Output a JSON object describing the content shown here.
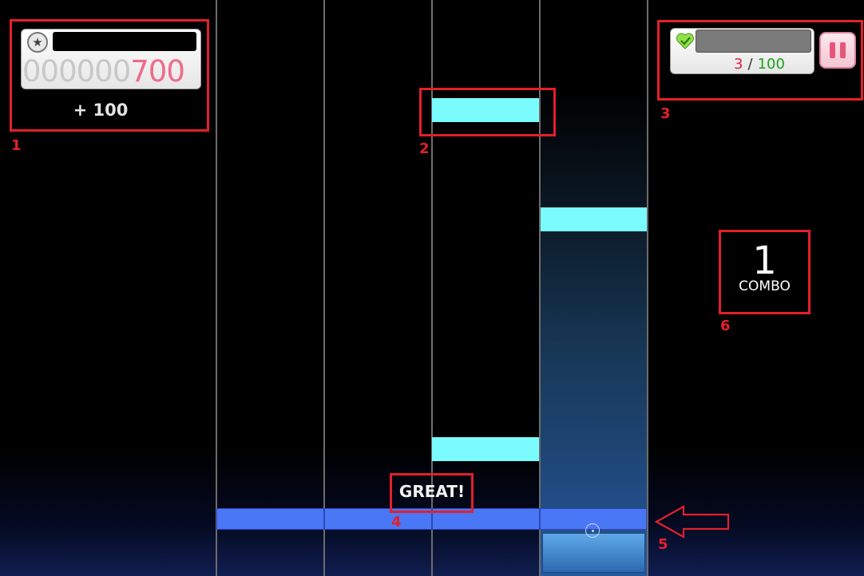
{
  "colors": {
    "note": "#7afcff",
    "judgement_line": "#4a77f5",
    "annotation": "#e2202b",
    "score_highlight": "#f06a8a",
    "life_current": "#e0223a",
    "life_max": "#1aa31a",
    "pause_accent": "#e8557a"
  },
  "score_panel": {
    "icon": "star-icon",
    "player_name": "",
    "score_padding": "000000",
    "score_value": "700",
    "delta": "+ 100"
  },
  "life_panel": {
    "icon": "heart-check-icon",
    "current": "3",
    "separator": "/",
    "max": "100",
    "pause_icon": "pause-icon"
  },
  "judgement": {
    "text": "GREAT!"
  },
  "combo": {
    "count": "1",
    "label": "COMBO"
  },
  "annotations": {
    "labels": [
      "1",
      "2",
      "3",
      "4",
      "5",
      "6"
    ]
  }
}
